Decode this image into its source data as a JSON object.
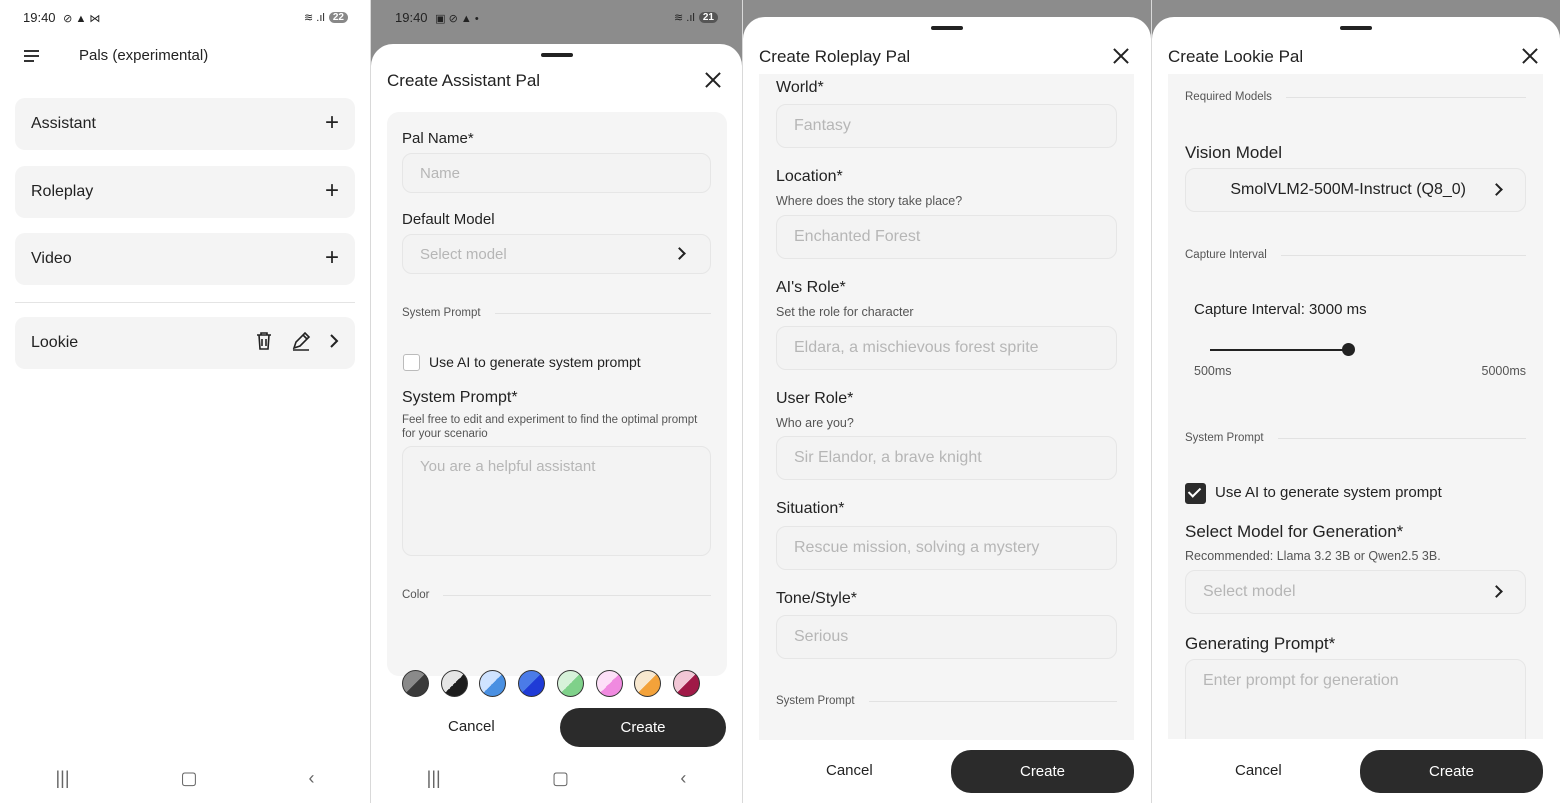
{
  "screen1": {
    "status": {
      "time": "19:40",
      "left_icons": "⊘ ▲ ⋈",
      "right_icons": "≋ .ıl",
      "battery": "22"
    },
    "title": "Pals (experimental)",
    "pals": [
      {
        "label": "Assistant"
      },
      {
        "label": "Roleplay"
      },
      {
        "label": "Video"
      }
    ],
    "saved_pal": {
      "label": "Lookie"
    }
  },
  "screen2": {
    "status": {
      "time": "19:40",
      "left_icons": "▣ ⊘ ▲ •",
      "right_icons": "≋ .ıl",
      "battery": "21"
    },
    "title": "Create Assistant Pal",
    "pal_name": {
      "label": "Pal Name*",
      "placeholder": "Name"
    },
    "default_model": {
      "label": "Default Model",
      "placeholder": "Select model"
    },
    "system_prompt_section": "System Prompt",
    "use_ai_label": "Use AI to generate system prompt",
    "system_prompt": {
      "label": "System Prompt*",
      "hint": "Feel free to edit and experiment to find the optimal prompt for your scenario",
      "placeholder": "You are a helpful assistant"
    },
    "color_section": "Color",
    "colors": [
      {
        "name": "gray",
        "primary": "#3a3a3a",
        "secondary": "#8a8a8a"
      },
      {
        "name": "black",
        "primary": "#1c1c1c",
        "secondary": "#e5e5e5"
      },
      {
        "name": "sky",
        "primary": "#4a90e2",
        "secondary": "#cfe3ff"
      },
      {
        "name": "blue",
        "primary": "#1f3bd6",
        "secondary": "#4b7be8"
      },
      {
        "name": "green",
        "primary": "#7fd18a",
        "secondary": "#d7f2da"
      },
      {
        "name": "pink",
        "primary": "#f08ae0",
        "secondary": "#fde0f8"
      },
      {
        "name": "orange",
        "primary": "#f3a23a",
        "secondary": "#f8e8cf"
      },
      {
        "name": "maroon",
        "primary": "#a01947",
        "secondary": "#f2c7d6"
      }
    ],
    "cancel": "Cancel",
    "create": "Create"
  },
  "screen3": {
    "title": "Create Roleplay Pal",
    "world": {
      "label": "World*",
      "placeholder": "Fantasy"
    },
    "location": {
      "label": "Location*",
      "hint": "Where does the story take place?",
      "placeholder": "Enchanted Forest"
    },
    "ai_role": {
      "label": "AI's Role*",
      "hint": "Set the role for character",
      "placeholder": "Eldara, a mischievous forest sprite"
    },
    "user_role": {
      "label": "User Role*",
      "hint": "Who are you?",
      "placeholder": "Sir Elandor, a brave knight"
    },
    "situation": {
      "label": "Situation*",
      "placeholder": "Rescue mission, solving a mystery"
    },
    "tone": {
      "label": "Tone/Style*",
      "placeholder": "Serious"
    },
    "system_prompt_section": "System Prompt",
    "cancel": "Cancel",
    "create": "Create"
  },
  "screen4": {
    "title": "Create Lookie Pal",
    "required_models_section": "Required Models",
    "vision_model": {
      "label": "Vision Model",
      "value": "SmolVLM2-500M-Instruct (Q8_0)"
    },
    "capture_section": "Capture Interval",
    "capture_label": "Capture Interval: 3000 ms",
    "slider": {
      "min_label": "500ms",
      "max_label": "5000ms",
      "min": 500,
      "max": 5000,
      "value": 3000
    },
    "system_prompt_section": "System Prompt",
    "use_ai_label": "Use AI to generate system prompt",
    "use_ai_checked": true,
    "gen_model": {
      "label": "Select Model for Generation*",
      "hint": "Recommended: Llama 3.2 3B or Qwen2.5 3B.",
      "placeholder": "Select model"
    },
    "gen_prompt": {
      "label": "Generating Prompt*",
      "placeholder": "Enter prompt for generation"
    },
    "cancel": "Cancel",
    "create": "Create"
  }
}
